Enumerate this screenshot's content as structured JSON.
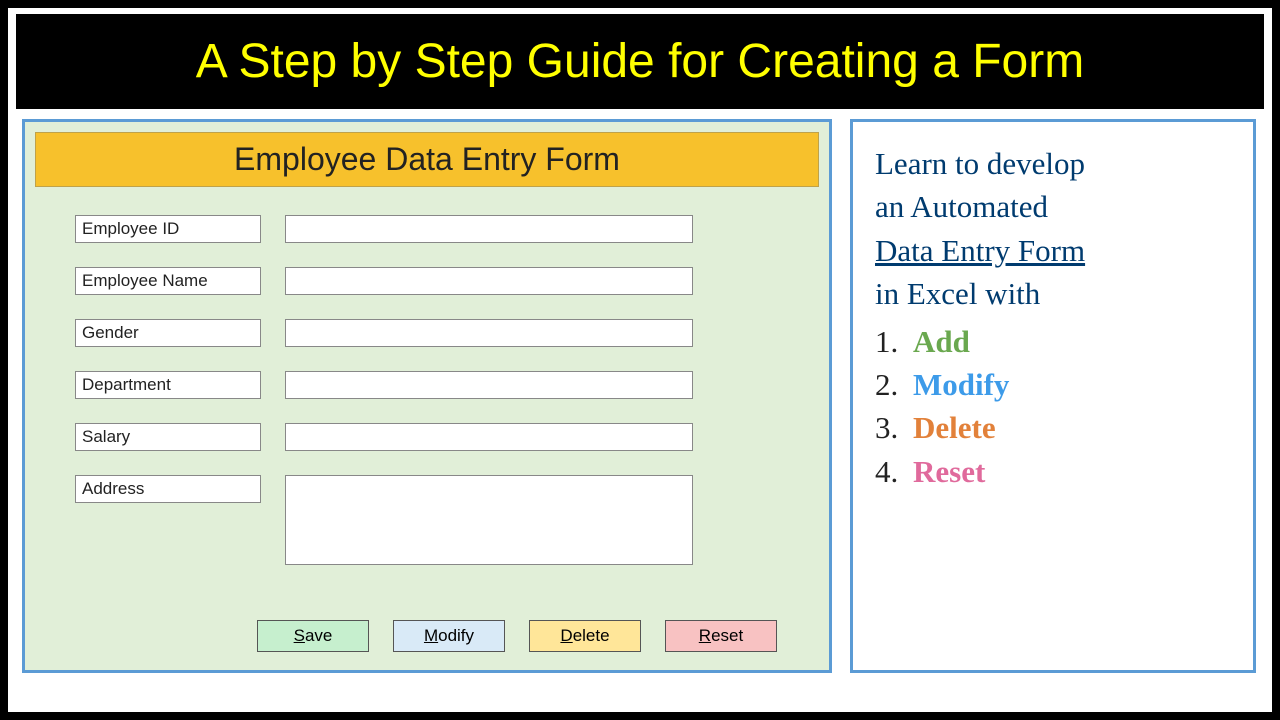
{
  "title": "A Step by Step Guide for Creating a Form",
  "form": {
    "header": "Employee Data Entry Form",
    "fields": [
      {
        "label": "Employee ID"
      },
      {
        "label": "Employee Name"
      },
      {
        "label": "Gender"
      },
      {
        "label": "Department"
      },
      {
        "label": "Salary"
      },
      {
        "label": "Address"
      }
    ],
    "buttons": {
      "save": {
        "prefix": "S",
        "rest": "ave"
      },
      "modify": {
        "prefix": "M",
        "rest": "odify"
      },
      "delete": {
        "prefix": "D",
        "rest": "elete"
      },
      "reset": {
        "prefix": "R",
        "rest": "eset"
      }
    }
  },
  "side": {
    "line1": "Learn to develop",
    "line2": "an Automated",
    "line3": "Data Entry Form",
    "line4": "in Excel with",
    "items": [
      {
        "num": "1.",
        "text": "Add",
        "cls": "c-add"
      },
      {
        "num": "2.",
        "text": "Modify",
        "cls": "c-modify"
      },
      {
        "num": "3.",
        "text": "Delete",
        "cls": "c-delete"
      },
      {
        "num": "4.",
        "text": "Reset",
        "cls": "c-reset"
      }
    ]
  }
}
